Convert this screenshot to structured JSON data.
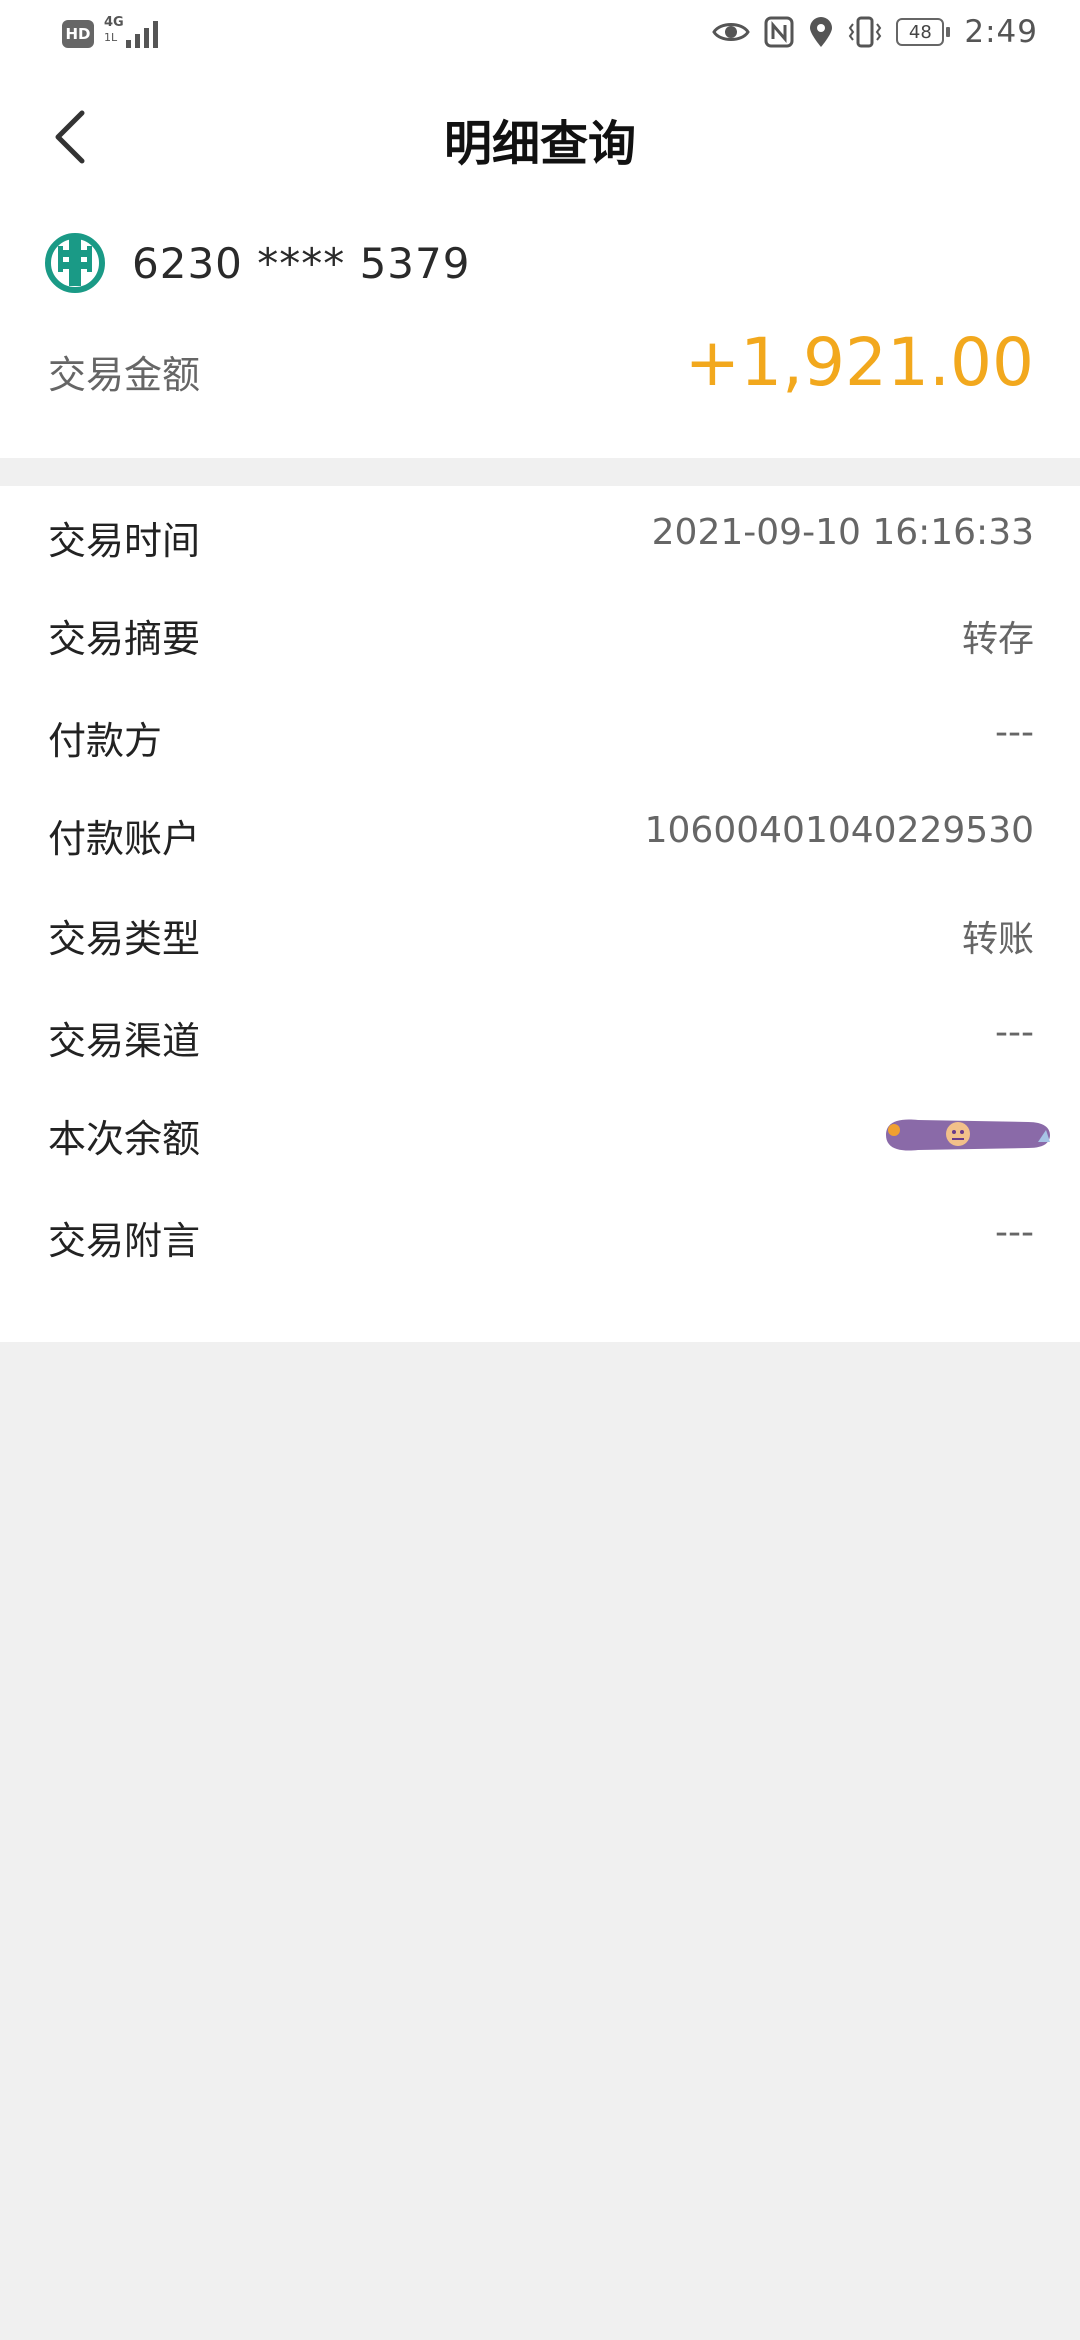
{
  "status_bar": {
    "hd": "HD",
    "network_top": "4G",
    "network_bottom": "1L",
    "battery": "48",
    "time": "2:49"
  },
  "header": {
    "title": "明细查询"
  },
  "account": {
    "number": "6230 **** 5379",
    "amount_label": "交易金额",
    "amount_value": "+1,921.00",
    "amount_color": "#f2a81d",
    "bank_logo_color": "#1a9a86"
  },
  "details": [
    {
      "label": "交易时间",
      "value": "2021-09-10 16:16:33"
    },
    {
      "label": "交易摘要",
      "value": "转存"
    },
    {
      "label": "付款方",
      "value": "---"
    },
    {
      "label": "付款账户",
      "value": "10600401040229530"
    },
    {
      "label": "交易类型",
      "value": "转账"
    },
    {
      "label": "交易渠道",
      "value": "---"
    },
    {
      "label": "本次余额",
      "value": ""
    },
    {
      "label": "交易附言",
      "value": "---"
    }
  ]
}
